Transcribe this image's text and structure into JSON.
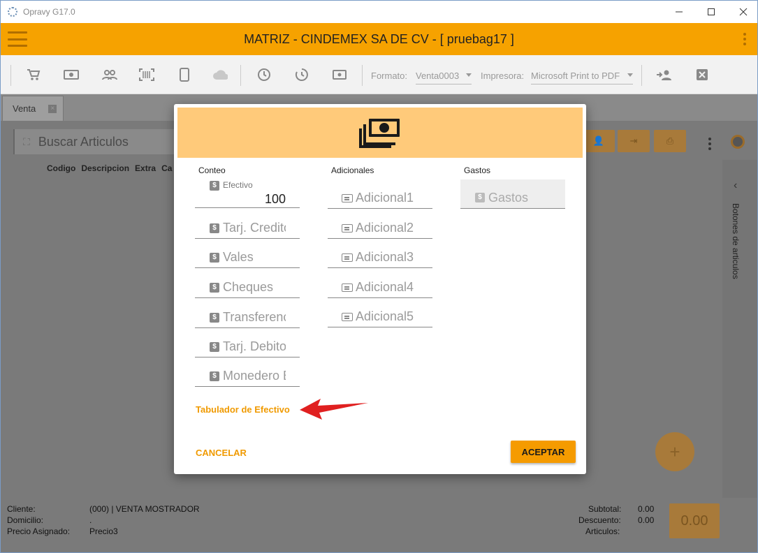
{
  "window": {
    "title": "Opravy G17.0"
  },
  "header": {
    "company": "MATRIZ - CINDEMEX SA DE CV - [ pruebag17 ]"
  },
  "toolbar": {
    "formato_label": "Formato:",
    "formato_value": "Venta0003",
    "impresora_label": "Impresora:",
    "impresora_value": "Microsoft Print to PDF"
  },
  "tabs": [
    {
      "label": "Venta"
    }
  ],
  "search": {
    "placeholder": "Buscar Articulos"
  },
  "table": {
    "columns": [
      "Codigo",
      "Descripcion",
      "Extra",
      "Ca"
    ]
  },
  "side_panel": {
    "label": "Botones de articulos"
  },
  "footer": {
    "cliente_label": "Cliente:",
    "cliente_value": "(000) | VENTA MOSTRADOR",
    "domicilio_label": "Domicilio:",
    "domicilio_value": ".",
    "precio_label": "Precio Asignado:",
    "precio_value": "Precio3",
    "subtotal_label": "Subtotal:",
    "subtotal_value": "0.00",
    "descuento_label": "Descuento:",
    "descuento_value": "0.00",
    "articulos_label": "Articulos:",
    "total": "0.00"
  },
  "dialog": {
    "conteo": {
      "title": "Conteo",
      "efectivo_label": "Efectivo",
      "efectivo_value": "100",
      "fields": [
        "Tarj. Credito",
        "Vales",
        "Cheques",
        "Transferencia",
        "Tarj. Debito",
        "Monedero E"
      ]
    },
    "adicionales": {
      "title": "Adicionales",
      "fields": [
        "Adicional1",
        "Adicional2",
        "Adicional3",
        "Adicional4",
        "Adicional5"
      ]
    },
    "gastos": {
      "title": "Gastos",
      "field": "Gastos"
    },
    "tabulador_link": "Tabulador de Efectivo",
    "cancel_label": "CANCELAR",
    "accept_label": "ACEPTAR"
  },
  "colors": {
    "accent": "#f6a200",
    "dialog_header": "#ffca7a",
    "link": "#f09a00",
    "arrow": "#e02020"
  }
}
